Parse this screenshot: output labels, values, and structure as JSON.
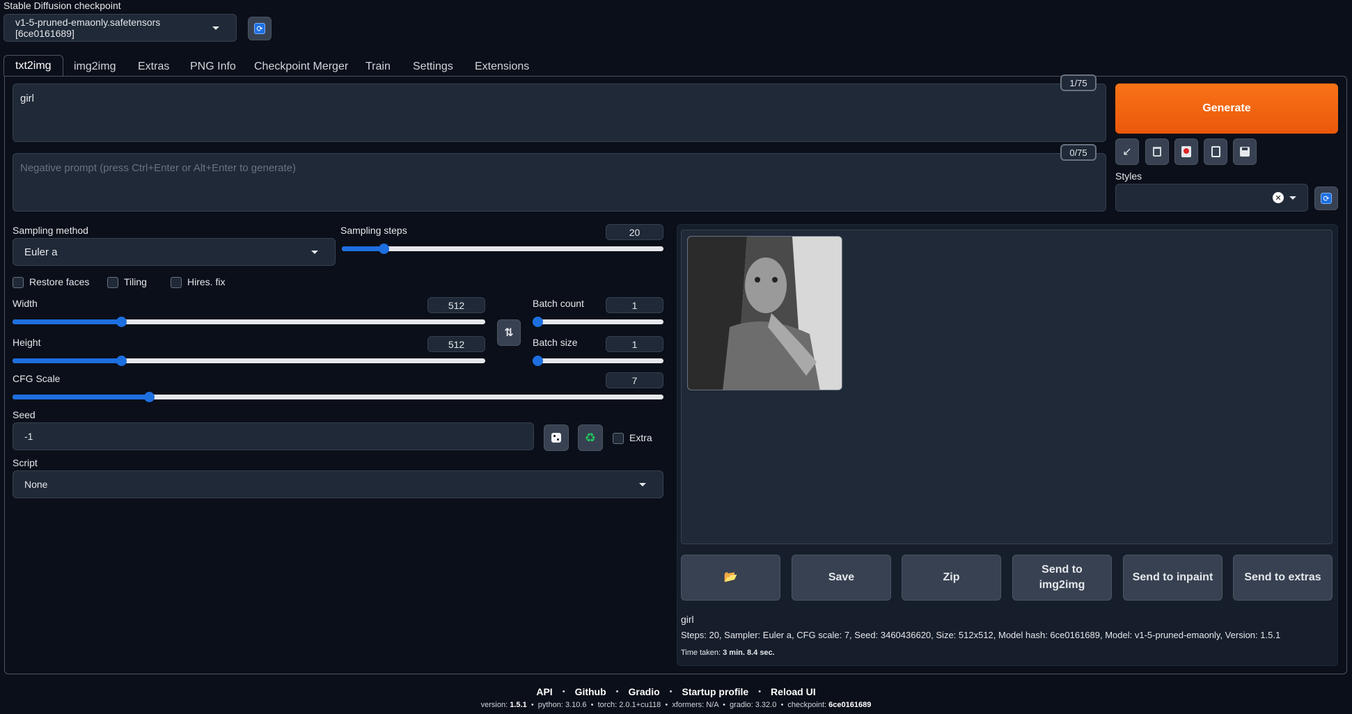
{
  "checkpoint": {
    "label": "Stable Diffusion checkpoint",
    "value": "v1-5-pruned-emaonly.safetensors [6ce0161689]"
  },
  "tabs": [
    "txt2img",
    "img2img",
    "Extras",
    "PNG Info",
    "Checkpoint Merger",
    "Train",
    "Settings",
    "Extensions"
  ],
  "prompt": {
    "value": "girl",
    "counter": "1/75"
  },
  "negative_prompt": {
    "placeholder": "Negative prompt (press Ctrl+Enter or Alt+Enter to generate)",
    "counter": "0/75"
  },
  "generate_label": "Generate",
  "styles_label": "Styles",
  "sampling": {
    "method_label": "Sampling method",
    "method_value": "Euler a",
    "steps_label": "Sampling steps",
    "steps_value": "20",
    "steps_fraction": 0.13
  },
  "options": {
    "restore_faces": "Restore faces",
    "tiling": "Tiling",
    "hires_fix": "Hires. fix"
  },
  "width": {
    "label": "Width",
    "value": "512",
    "fraction": 0.23
  },
  "height": {
    "label": "Height",
    "value": "512",
    "fraction": 0.23
  },
  "batch_count": {
    "label": "Batch count",
    "value": "1",
    "fraction": 0.0
  },
  "batch_size": {
    "label": "Batch size",
    "value": "1",
    "fraction": 0.0
  },
  "cfg": {
    "label": "CFG Scale",
    "value": "7",
    "fraction": 0.21
  },
  "seed": {
    "label": "Seed",
    "value": "-1",
    "extra_label": "Extra"
  },
  "script": {
    "label": "Script",
    "value": "None"
  },
  "output_buttons": {
    "folder": "📂",
    "save": "Save",
    "zip": "Zip",
    "send_img2img_1": "Send to",
    "send_img2img_2": "img2img",
    "send_inpaint": "Send to inpaint",
    "send_extras": "Send to extras"
  },
  "info": {
    "prompt": "girl",
    "params": "Steps: 20, Sampler: Euler a, CFG scale: 7, Seed: 3460436620, Size: 512x512, Model hash: 6ce0161689, Model: v1-5-pruned-emaonly, Version: 1.5.1",
    "time_label": "Time taken:",
    "time_value": "3 min. 8.4 sec."
  },
  "footer": {
    "links": [
      "API",
      "Github",
      "Gradio",
      "Startup profile",
      "Reload UI"
    ],
    "version_label": "version:",
    "version": "1.5.1",
    "python_label": "python:",
    "python": "3.10.6",
    "torch_label": "torch:",
    "torch": "2.0.1+cu118",
    "xformers_label": "xformers:",
    "xformers": "N/A",
    "gradio_label": "gradio:",
    "gradio": "3.32.0",
    "checkpoint_label": "checkpoint:",
    "checkpoint": "6ce0161689"
  },
  "colors": {
    "accent": "#1d6fe0",
    "generate": "#ea580c",
    "background": "#0b0f19",
    "panel": "#1f2937"
  }
}
